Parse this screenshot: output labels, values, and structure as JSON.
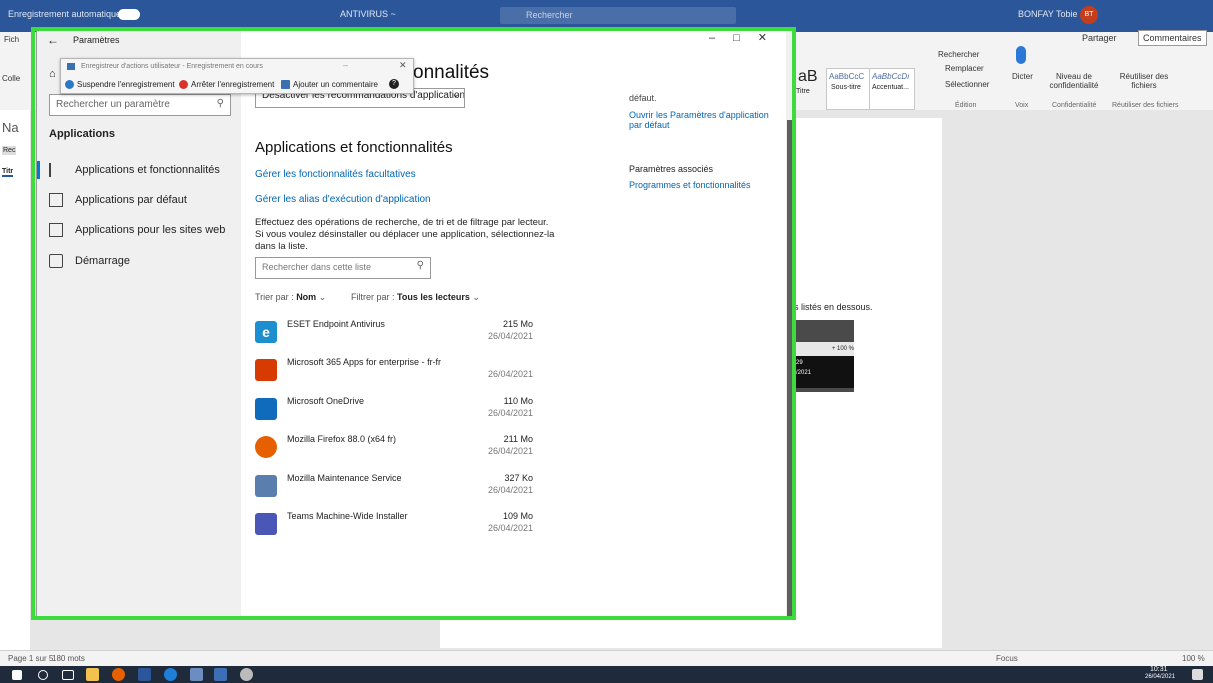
{
  "word": {
    "titlebar": {
      "autosave": "Enregistrement automatique",
      "doc": "ANTIVIRUS ~",
      "search": "Rechercher",
      "user": "BONFAY Tobie",
      "user_initials": "BT"
    },
    "tabs_left": [
      "Fich",
      "Colle"
    ],
    "share_label": "Partager",
    "comments_label": "Commentaires",
    "styles": [
      {
        "sample": "aB",
        "name": "Titre"
      },
      {
        "sample": "AaBbCcC",
        "name": "Sous-titre"
      },
      {
        "sample": "AaBbCcDı",
        "name": "Accentuat..."
      }
    ],
    "edit_group": {
      "find": "Rechercher",
      "replace": "Remplacer",
      "select": "Sélectionner",
      "label": "Édition"
    },
    "dictate": {
      "label": "Dicter",
      "group": "Voix"
    },
    "confidentiality": {
      "label": "Niveau de confidentialité",
      "group": "Confidentialité"
    },
    "reuse": {
      "label": "Réutiliser des fichiers",
      "group": "Réutiliser des fichiers"
    },
    "nav_pane_letters": [
      "Na",
      "Rec",
      "Titr"
    ],
    "page_text": "s listés en dessous.",
    "snippet": {
      "zoom": "+ 100 %",
      "time": "29",
      "date": "/2021"
    },
    "status": {
      "page": "Page 1 sur 5",
      "words": "180 mots",
      "focus": "Focus",
      "zoom": "100 %"
    }
  },
  "taskbar": {
    "time": "10:31",
    "date": "26/04/2021"
  },
  "settings": {
    "window_title": "Paramètres",
    "search_placeholder": "Rechercher un paramètre",
    "section": "Applications",
    "nav": [
      {
        "label": "Applications et fonctionnalités",
        "icon": "list-icon"
      },
      {
        "label": "Applications par défaut",
        "icon": "default-apps-icon"
      },
      {
        "label": "Applications pour les sites web",
        "icon": "web-apps-icon"
      },
      {
        "label": "Démarrage",
        "icon": "startup-icon"
      }
    ],
    "page_title_partial": "onnalités",
    "dropdown_value": "Désactiver les recommandations d'application",
    "heading": "Applications et fonctionnalités",
    "link_optional": "Gérer les fonctionnalités facultatives",
    "link_alias": "Gérer les alias d'exécution d'application",
    "description": "Effectuez des opérations de recherche, de tri et de filtrage par lecteur. Si vous voulez désinstaller ou déplacer une application, sélectionnez-la dans la liste.",
    "list_search_placeholder": "Rechercher dans cette liste",
    "sort_label": "Trier par :",
    "sort_value": "Nom",
    "filter_label": "Filtrer par :",
    "filter_value": "Tous les lecteurs",
    "apps": [
      {
        "name": "ESET Endpoint Antivirus",
        "size": "215 Mo",
        "date": "26/04/2021",
        "color": "#1d8fcf"
      },
      {
        "name": "Microsoft 365 Apps for enterprise - fr-fr",
        "size": "",
        "date": "26/04/2021",
        "color": "#d83b01"
      },
      {
        "name": "Microsoft OneDrive",
        "size": "110 Mo",
        "date": "26/04/2021",
        "color": "#0f6cbd"
      },
      {
        "name": "Mozilla Firefox 88.0 (x64 fr)",
        "size": "211 Mo",
        "date": "26/04/2021",
        "color": "#e66000"
      },
      {
        "name": "Mozilla Maintenance Service",
        "size": "327 Ko",
        "date": "26/04/2021",
        "color": "#5a7fae"
      },
      {
        "name": "Teams Machine-Wide Installer",
        "size": "109 Mo",
        "date": "26/04/2021",
        "color": "#4b57b6"
      }
    ],
    "right_top_text": "défaut.",
    "right_link": "Ouvrir les Paramètres d'application par défaut",
    "related_heading": "Paramètres associés",
    "related_link": "Programmes et fonctionnalités"
  },
  "recorder": {
    "title": "Enregistreur d'actions utilisateur - Enregistrement en cours",
    "pause": "Suspendre l'enregistrement",
    "stop": "Arrêter l'enregistrement",
    "comment": "Ajouter un commentaire"
  }
}
